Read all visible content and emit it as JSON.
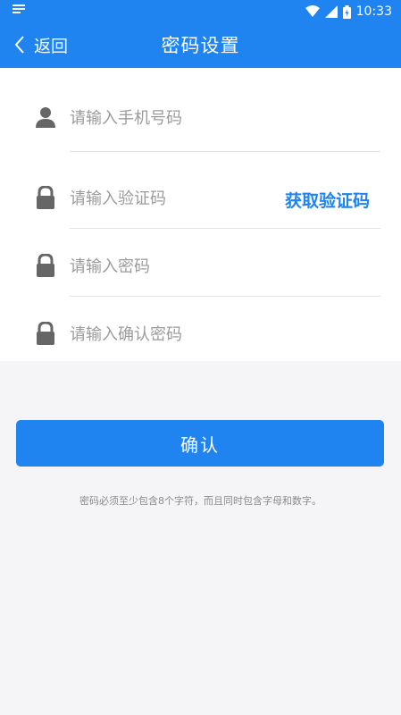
{
  "status_bar": {
    "time": "10:33"
  },
  "app_bar": {
    "back_label": "返回",
    "title": "密码设置"
  },
  "form": {
    "phone": {
      "placeholder": "请输入手机号码"
    },
    "code": {
      "placeholder": "请输入验证码",
      "get_code_label": "获取验证码"
    },
    "password": {
      "placeholder": "请输入密码"
    },
    "confirm_password": {
      "placeholder": "请输入确认密码"
    }
  },
  "confirm_button": {
    "label": "确认"
  },
  "hint": {
    "text": "密码必须至少包含8个字符，而且同时包含字母和数字。"
  },
  "colors": {
    "accent": "#1f83f0",
    "background": "#f5f5f7",
    "icon": "#666666"
  },
  "icons": [
    "user-icon",
    "lock-icon",
    "chevron-left-icon",
    "wifi-icon",
    "signal-icon",
    "battery-icon"
  ]
}
